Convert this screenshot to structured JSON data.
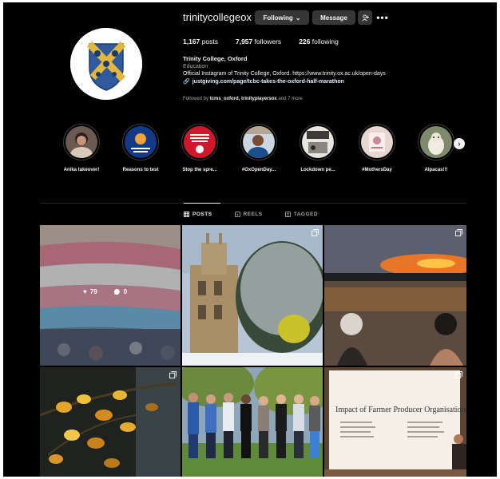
{
  "profile": {
    "username": "trinitycollegeox",
    "following_label": "Following",
    "message_label": "Message",
    "posts_count": "1,167",
    "posts_label": "posts",
    "followers_count": "7,957",
    "followers_label": "followers",
    "following_count": "226",
    "following_count_label": "following",
    "full_name": "Trinity College, Oxford",
    "category": "Education",
    "bio": "Official Instagram of Trinity College, Oxford. https://www.trinity.ox.ac.uk/open-days",
    "link": "justgiving.com/page/tcbc-takes-the-oxford-half-marathon",
    "followed_by_prefix": "Followed by",
    "followed_by_names": "tcms_oxford, trinityplayersox",
    "followed_by_suffix": "and 7 more"
  },
  "highlights": [
    {
      "label": "Anika takeover!",
      "icon": "person-portrait"
    },
    {
      "label": "Reasons to test",
      "icon": "info-badge"
    },
    {
      "label": "Stop the spre...",
      "icon": "red-poster"
    },
    {
      "label": "#OxOpenDay...",
      "icon": "person-portrait"
    },
    {
      "label": "Lockdown pe...",
      "icon": "poster"
    },
    {
      "label": "#MothersDay",
      "icon": "card"
    },
    {
      "label": "Alpacas!!!",
      "icon": "alpaca"
    }
  ],
  "tabs": [
    {
      "label": "POSTS",
      "icon": "grid-icon",
      "active": true
    },
    {
      "label": "REELS",
      "icon": "reels-icon",
      "active": false
    },
    {
      "label": "TAGGED",
      "icon": "tagged-icon",
      "active": false
    }
  ],
  "posts": [
    {
      "subject": "trans pride flag",
      "likes": "79",
      "comments": "0"
    },
    {
      "subject": "college chapel in snow"
    },
    {
      "subject": "sunset swimmers"
    },
    {
      "subject": "autumn leaves"
    },
    {
      "subject": "group photo in park"
    },
    {
      "subject": "presentation slide",
      "poster_title": "Impact of Farmer Producer Organisations"
    }
  ],
  "colors": {
    "background": "#000000",
    "button": "#363636",
    "text": "#f5f5f5",
    "muted": "#a8a8a8",
    "link": "#e0f1ff"
  }
}
